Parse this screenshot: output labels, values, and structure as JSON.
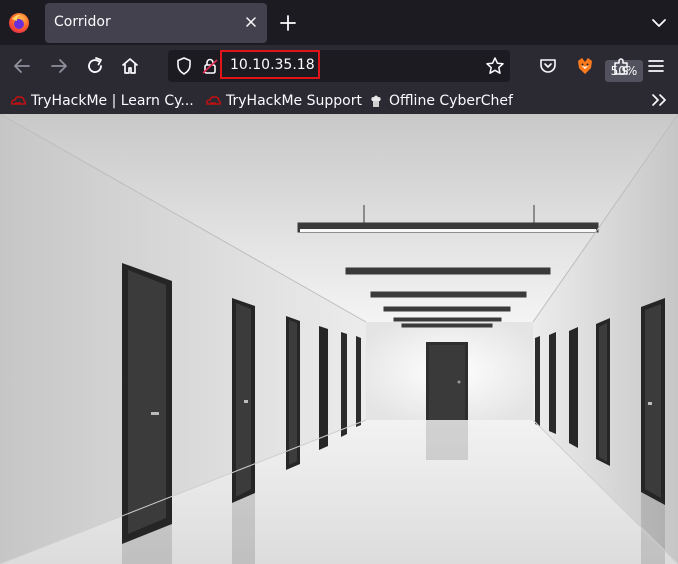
{
  "browser": {
    "tab": {
      "title": "Corridor"
    },
    "url": "10.10.35.18",
    "zoom": "50%"
  },
  "bookmarks": [
    {
      "label": "TryHackMe | Learn Cy...",
      "icon": "tryhackme-icon"
    },
    {
      "label": "TryHackMe Support",
      "icon": "tryhackme-icon"
    },
    {
      "label": "Offline CyberChef",
      "icon": "cyberchef-icon"
    }
  ],
  "colors": {
    "tab_bg": "#42414d",
    "toolbar_bg": "#2b2a33",
    "frame_bg": "#1c1b22",
    "url_highlight": "#e0151a",
    "tryhackme_red": "#c11111"
  },
  "content": {
    "image": "white-hallway-with-dark-doors"
  }
}
